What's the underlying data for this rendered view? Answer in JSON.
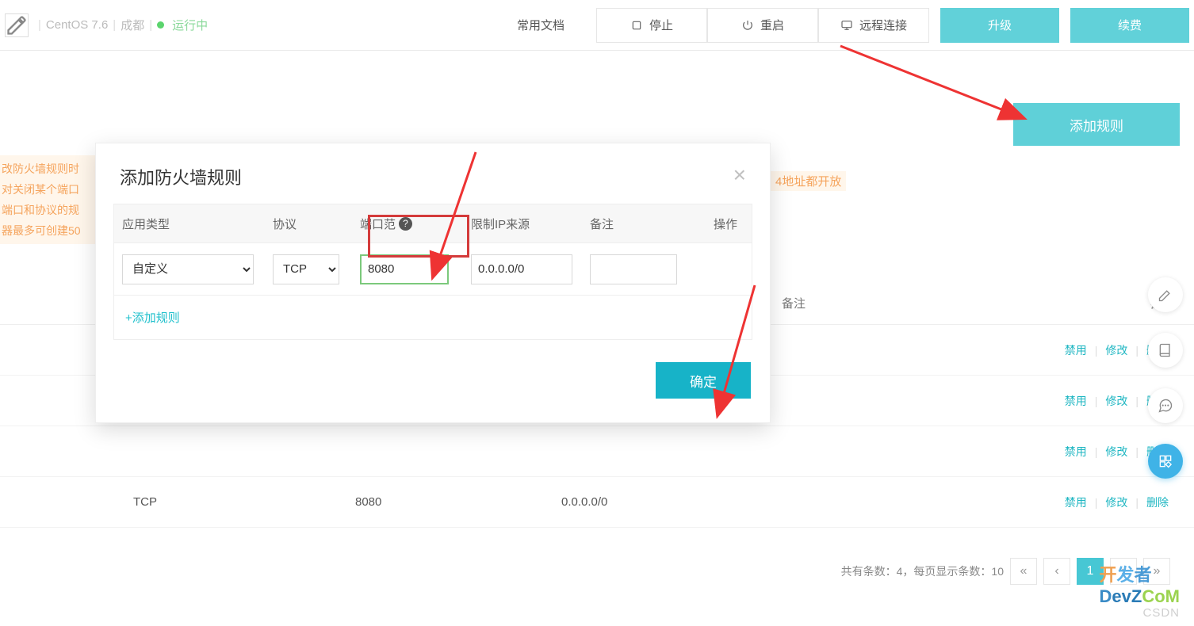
{
  "header": {
    "os": "CentOS 7.6",
    "region": "成都",
    "status": "运行中",
    "docs": "常用文档",
    "stop": "停止",
    "restart": "重启",
    "remote": "远程连接",
    "upgrade": "升级",
    "renew": "续费"
  },
  "add_rule_btn": "添加规则",
  "bg_warning_lines": [
    "改防火墙规则时",
    "对关闭某个端口",
    "端口和协议的规",
    "器最多可创建50"
  ],
  "bg_warning_right": "4地址都开放",
  "bg_table": {
    "head_note": "备注",
    "head_ops": "操",
    "rows": [
      {
        "proto": "",
        "port": "",
        "ip": "",
        "ops": [
          "禁用",
          "修改",
          "删除"
        ]
      },
      {
        "proto": "",
        "port": "",
        "ip": "",
        "ops": [
          "禁用",
          "修改",
          "删除"
        ]
      },
      {
        "proto": "",
        "port": "",
        "ip": "",
        "ops": [
          "禁用",
          "修改",
          "删除"
        ]
      },
      {
        "proto": "TCP",
        "port": "8080",
        "ip": "0.0.0.0/0",
        "ops": [
          "禁用",
          "修改",
          "删除"
        ]
      }
    ]
  },
  "pagination": {
    "summary": "共有条数：4，每页显示条数：10",
    "first": "«",
    "prev": "‹",
    "page": "1",
    "next": "›",
    "last": "»"
  },
  "modal": {
    "title": "添加防火墙规则",
    "head": {
      "app_type": "应用类型",
      "protocol": "协议",
      "port_range": "端口范",
      "limit_ip": "限制IP来源",
      "remark": "备注",
      "ops": "操作"
    },
    "row": {
      "app_type_value": "自定义",
      "protocol_value": "TCP",
      "port_value": "8080",
      "ip_value": "0.0.0.0/0",
      "remark_value": ""
    },
    "add_line": "+添加规则",
    "ok": "确定"
  },
  "watermark": "CSDN",
  "brand": {
    "a": "开",
    "b": "发",
    "c": "者",
    "d": "D",
    "e": "evZ",
    "f": "CoM"
  }
}
